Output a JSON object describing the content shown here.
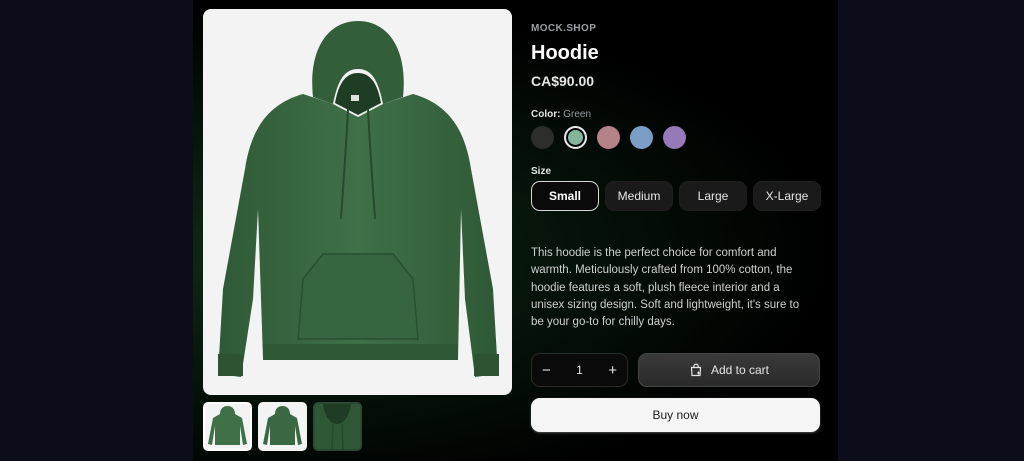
{
  "store": {
    "name": "MOCK.SHOP"
  },
  "product": {
    "title": "Hoodie",
    "price": "CA$90.00",
    "description": "This hoodie is the perfect choice for comfort and warmth. Meticulously crafted from 100% cotton, the hoodie features a soft, plush fleece interior and a unisex sizing design. Soft and lightweight, it's sure to be your go-to for chilly days."
  },
  "color": {
    "label": "Color:",
    "selected": "Green",
    "options": [
      {
        "name": "Black",
        "hex": "#2b2e29"
      },
      {
        "name": "Green",
        "hex": "#83b59c"
      },
      {
        "name": "Pink",
        "hex": "#b5828a"
      },
      {
        "name": "Blue",
        "hex": "#7b9ec7"
      },
      {
        "name": "Purple",
        "hex": "#9579b8"
      }
    ]
  },
  "size": {
    "label": "Size",
    "options": [
      "Small",
      "Medium",
      "Large",
      "X-Large"
    ],
    "selected": "Small"
  },
  "cart": {
    "quantity": "1",
    "minus": "−",
    "plus": "+",
    "add_label": "Add to cart",
    "buy_label": "Buy now"
  },
  "colors": {
    "hoodie_green": "#3f7048",
    "hoodie_dark": "#2f5936"
  },
  "icons": {
    "cart": "shopping-bag-icon"
  }
}
